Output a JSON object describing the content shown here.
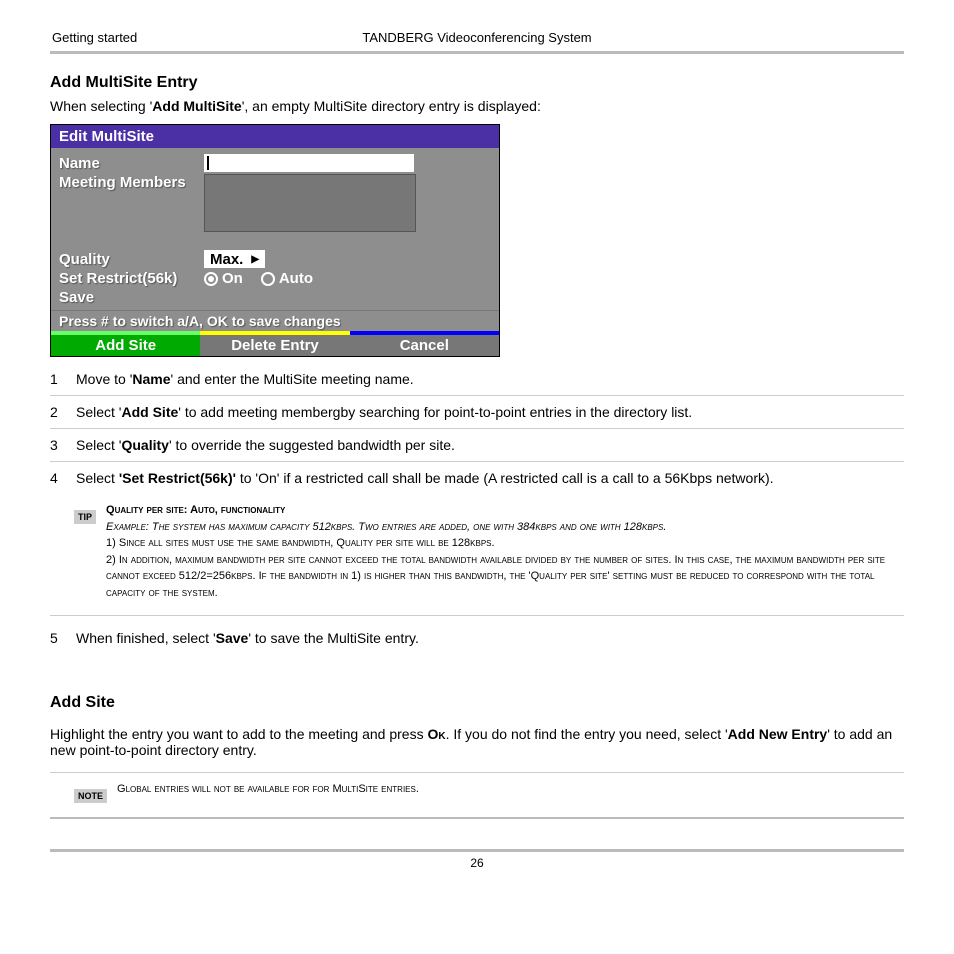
{
  "header": {
    "left": "Getting started",
    "center": "TANDBERG Videoconferencing System"
  },
  "section1": {
    "title": "Add MultiSite Entry",
    "intro_pre": "When selecting '",
    "intro_bold": "Add MultiSite",
    "intro_post": "', an empty MultiSite directory entry is displayed:"
  },
  "dialog": {
    "title": "Edit MultiSite",
    "rows": {
      "name": "Name",
      "members": "Meeting Members",
      "quality": "Quality",
      "quality_val": "Max.",
      "restrict": "Set Restrict(56k)",
      "restrict_on": "On",
      "restrict_auto": "Auto",
      "save": "Save"
    },
    "hint": "Press # to switch a/A, OK to save changes",
    "buttons": {
      "add": "Add Site",
      "delete": "Delete Entry",
      "cancel": "Cancel"
    }
  },
  "steps": {
    "s1": {
      "num": "1",
      "pre": "Move to '",
      "b": "Name",
      "post": "' and enter the MultiSite meeting name."
    },
    "s2": {
      "num": "2",
      "pre": "Select '",
      "b": "Add Site",
      "post": "' to add meeting membergby searching for point-to-point entries in the directory list."
    },
    "s3": {
      "num": "3",
      "pre": "Select '",
      "b": "Quality",
      "post": "' to override the suggested bandwidth per site."
    },
    "s4": {
      "num": "4",
      "pre": "Select ",
      "b": "'Set Restrict(56k)'",
      "post": " to 'On' if a restricted call shall be made (A restricted call is a call to a 56Kbps network)."
    },
    "s5": {
      "num": "5",
      "pre": "When finished, select '",
      "b": "Save",
      "post": "' to save the MultiSite entry."
    }
  },
  "tip": {
    "badge": "TIP",
    "title": "Quality per site: Auto, functionality",
    "line1": "Example:  The system has maximum capacity 512kbps. Two entries are added, one with 384kbps and one with 128kbps.",
    "line2": "1) Since all sites must use the same bandwidth, Quality per site will be 128kbps.",
    "line3": "2) In addition, maximum bandwidth per site cannot exceed the total bandwidth available divided by the number of sites. In this case, the maximum bandwidth per site cannot exceed 512/2=256kbps. If the bandwidth in 1) is higher than this bandwidth, the 'Quality per site' setting must be reduced to correspond with the total capacity of the system."
  },
  "section2": {
    "title": "Add Site",
    "body_pre": "Highlight the entry you want to add to the meeting and press ",
    "body_ok": "Ok",
    "body_mid": ". If you do not find the entry you need, select '",
    "body_bold": "Add New Entry",
    "body_post": "' to add an new point-to-point directory entry."
  },
  "note": {
    "badge": "NOTE",
    "text": "Global entries will not be available for for MultiSite entries."
  },
  "page": "26"
}
